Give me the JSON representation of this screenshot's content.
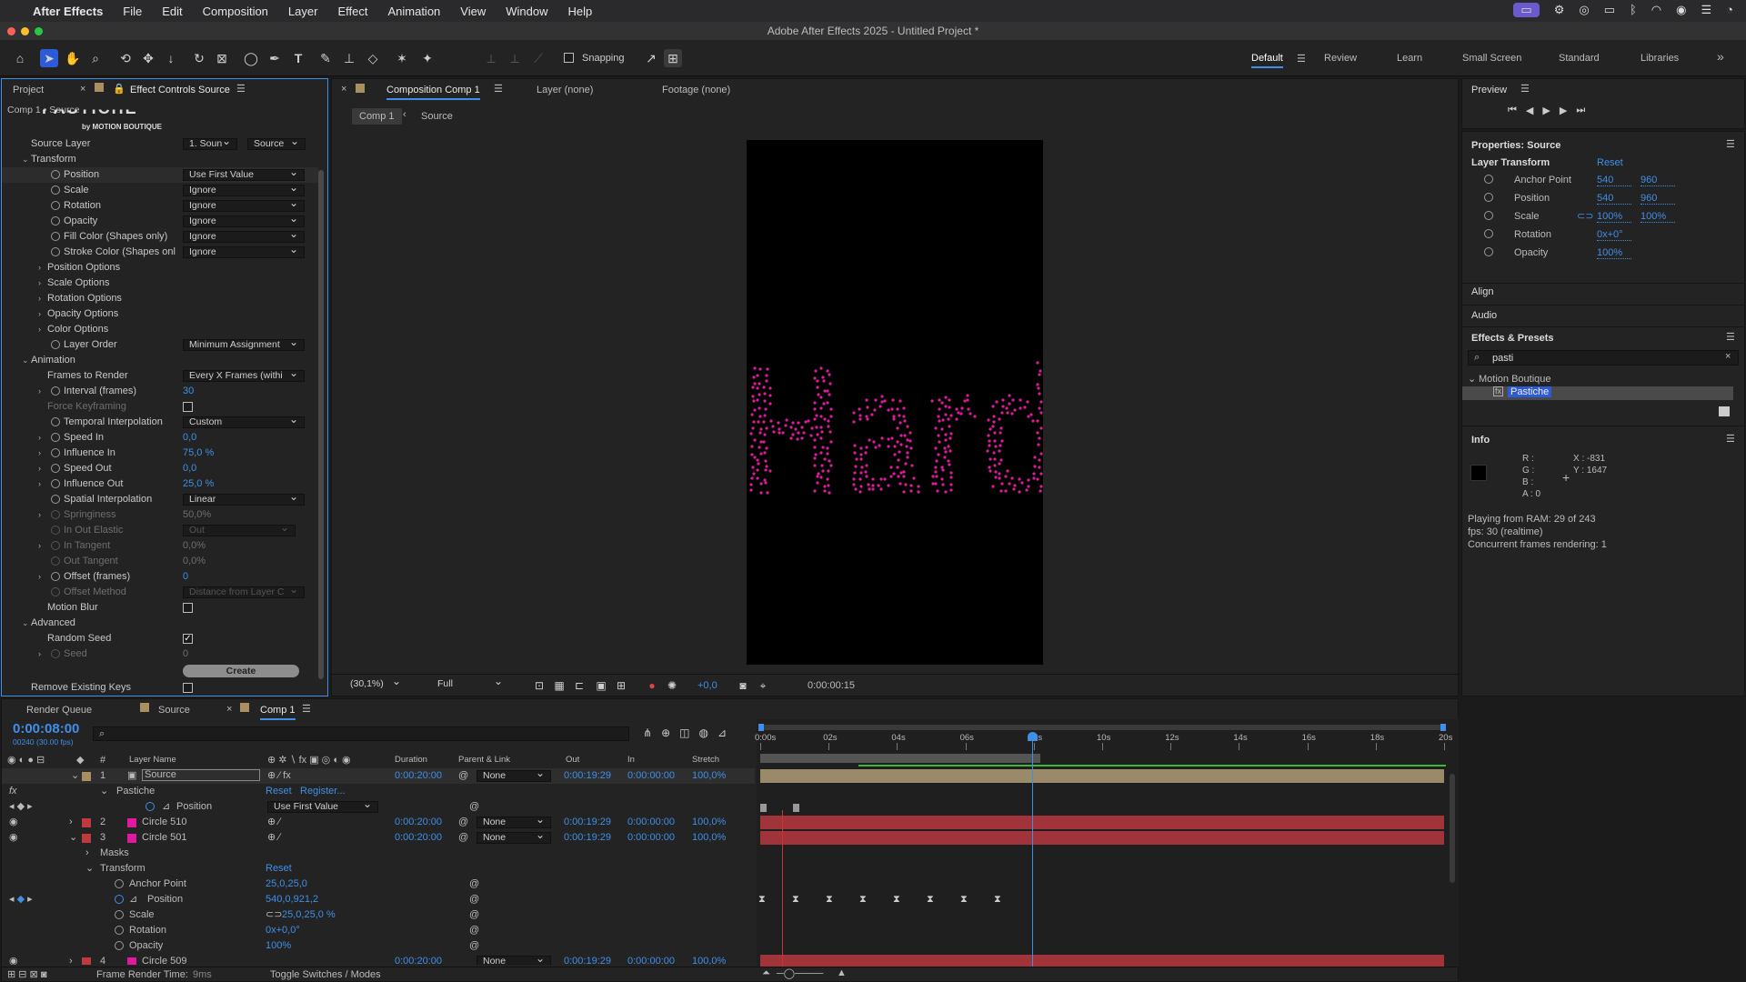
{
  "menubar": {
    "apple": "",
    "app": "After Effects",
    "items": [
      "File",
      "Edit",
      "Composition",
      "Layer",
      "Effect",
      "Animation",
      "View",
      "Window",
      "Help"
    ]
  },
  "titlebar": {
    "title": "Adobe After Effects 2025 - Untitled Project *"
  },
  "toolbar": {
    "snapping": "Snapping",
    "workspaces": [
      "Default",
      "Review",
      "Learn",
      "Small Screen",
      "Standard",
      "Libraries"
    ]
  },
  "left_panel": {
    "tab_project": "Project",
    "tab_effect": "Effect Controls Source",
    "breadcrumb": "Comp 1 • Source",
    "logo_text": "PASTICHE",
    "logo_sub": "by MOTION BOUTIQUE",
    "source_layer": {
      "label": "Source Layer",
      "v1": "1. Soun",
      "v2": "Source"
    },
    "transform": "Transform",
    "props": [
      {
        "label": "Position",
        "value": "Use First Value"
      },
      {
        "label": "Scale",
        "value": "Ignore"
      },
      {
        "label": "Rotation",
        "value": "Ignore"
      },
      {
        "label": "Opacity",
        "value": "Ignore"
      },
      {
        "label": "Fill Color (Shapes only)",
        "value": "Ignore"
      },
      {
        "label": "Stroke Color (Shapes onl",
        "value": "Ignore"
      }
    ],
    "options": [
      "Position Options",
      "Scale Options",
      "Rotation Options",
      "Opacity Options",
      "Color Options"
    ],
    "layer_order": {
      "label": "Layer Order",
      "value": "Minimum Assignment"
    },
    "animation": "Animation",
    "frames_to_render": {
      "label": "Frames to Render",
      "value": "Every X Frames (withi"
    },
    "interval": {
      "label": "Interval (frames)",
      "value": "30"
    },
    "force_kf": "Force Keyframing",
    "temporal": {
      "label": "Temporal Interpolation",
      "value": "Custom"
    },
    "speed_in": {
      "label": "Speed In",
      "value": "0,0"
    },
    "influence_in": {
      "label": "Influence In",
      "value": "75,0 %"
    },
    "speed_out": {
      "label": "Speed Out",
      "value": "0,0"
    },
    "influence_out": {
      "label": "Influence Out",
      "value": "25,0 %"
    },
    "spatial": {
      "label": "Spatial Interpolation",
      "value": "Linear"
    },
    "springiness": {
      "label": "Springiness",
      "value": "50,0%"
    },
    "in_out_elastic": {
      "label": "In Out Elastic",
      "value": "Out"
    },
    "in_tangent": {
      "label": "In Tangent",
      "value": "0,0%"
    },
    "out_tangent": {
      "label": "Out Tangent",
      "value": "0,0%"
    },
    "offset_frames": {
      "label": "Offset (frames)",
      "value": "0"
    },
    "offset_method": {
      "label": "Offset Method",
      "value": "Distance from Layer C"
    },
    "motion_blur": "Motion Blur",
    "advanced": "Advanced",
    "random_seed": "Random Seed",
    "seed": {
      "label": "Seed",
      "value": "0"
    },
    "create": "Create",
    "remove_kf": "Remove Existing Keys"
  },
  "comp_panel": {
    "tab": "Composition Comp 1",
    "layer_tab": "Layer (none)",
    "footage_tab": "Footage (none)",
    "crumb1": "Comp 1",
    "crumb2": "Source",
    "zoom": "(30,1%)",
    "res": "Full",
    "exposure": "+0,0",
    "timecode": "0:00:00:15",
    "canvas_text": "Hard"
  },
  "right_panel": {
    "preview": "Preview",
    "props_title": "Properties: Source",
    "layer_transform": "Layer Transform",
    "reset": "Reset",
    "props": [
      {
        "label": "Anchor Point",
        "v1": "540",
        "v2": "960"
      },
      {
        "label": "Position",
        "v1": "540",
        "v2": "960"
      },
      {
        "label": "Scale",
        "v1": "100%",
        "v2": "100%"
      },
      {
        "label": "Rotation",
        "v1": "0x+0°",
        "v2": ""
      },
      {
        "label": "Opacity",
        "v1": "100%",
        "v2": ""
      }
    ],
    "align": "Align",
    "audio": "Audio",
    "effects": "Effects & Presets",
    "search": "pasti",
    "folder": "Motion Boutique",
    "item": "Pastiche",
    "info": "Info",
    "r": "R :",
    "g": "G :",
    "b": "B :",
    "a": "A :  0",
    "x": "X : -831",
    "y": "Y : 1647",
    "line1": "Playing from RAM: 29 of 243",
    "line2": "fps: 30 (realtime)",
    "line3": "Concurrent frames rendering: 1"
  },
  "timeline": {
    "tab_rq": "Render Queue",
    "tab_source": "Source",
    "tab_comp": "Comp 1",
    "timecode": "0:00:08:00",
    "fps": "00240 (30.00 fps)",
    "cols": {
      "num": "#",
      "name": "Layer Name",
      "duration": "Duration",
      "parent": "Parent & Link",
      "out": "Out",
      "in": "In",
      "stretch": "Stretch"
    },
    "ruler": [
      "0:00s",
      "02s",
      "04s",
      "06s",
      "08s",
      "10s",
      "12s",
      "14s",
      "16s",
      "18s",
      "20s"
    ],
    "layers": [
      {
        "num": "1",
        "name": "Source",
        "duration": "0:00:20:00",
        "parent": "None",
        "out": "0:00:19:29",
        "in": "0:00:00:00",
        "stretch": "100,0%"
      },
      {
        "num": "2",
        "name": "Circle 510",
        "duration": "0:00:20:00",
        "parent": "None",
        "out": "0:00:19:29",
        "in": "0:00:00:00",
        "stretch": "100,0%"
      },
      {
        "num": "3",
        "name": "Circle 501",
        "duration": "0:00:20:00",
        "parent": "None",
        "out": "0:00:19:29",
        "in": "0:00:00:00",
        "stretch": "100,0%"
      },
      {
        "num": "4",
        "name": "Circle 509",
        "duration": "0:00:20:00",
        "parent": "None",
        "out": "0:00:19:29",
        "in": "0:00:00:00",
        "stretch": "100,0%"
      }
    ],
    "pastiche": "Pastiche",
    "reset": "Reset",
    "register": "Register...",
    "position": "Position",
    "use_first": "Use First Value",
    "masks": "Masks",
    "transform": "Transform",
    "tprops": [
      {
        "label": "Anchor Point",
        "value": "25,0,25,0"
      },
      {
        "label": "Position",
        "value": "540,0,921,2"
      },
      {
        "label": "Scale",
        "value": "25,0,25,0 %"
      },
      {
        "label": "Rotation",
        "value": "0x+0,0°"
      },
      {
        "label": "Opacity",
        "value": "100%"
      }
    ],
    "frame_render": "Frame Render Time:",
    "frame_render_val": "9ms",
    "toggle": "Toggle Switches / Modes"
  },
  "colors": {
    "accent": "#3f8fe8",
    "layer_bar": "#a0343a",
    "source_bar": "#9a8a6a",
    "dot": "#e0199e"
  }
}
